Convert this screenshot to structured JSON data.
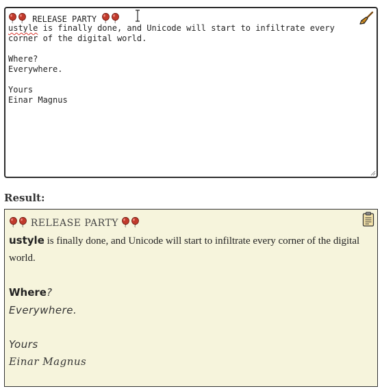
{
  "editor": {
    "lines": [
      "RELEASE PARTY",
      "is finally done, and Unicode will start to infiltrate every",
      "corner of the digital world.",
      "",
      "Where?",
      "Everywhere.",
      "",
      "Yours",
      "Einar Magnus"
    ],
    "misspelled_word": "ustyle",
    "clear_icon": "broom-icon"
  },
  "result_label": "Result:",
  "result": {
    "title": "RELEASE PARTY",
    "strong_word": "ustyle",
    "body_text": " is finally done, and Unicode will start to infiltrate every corner of the digital world.",
    "where_bold": "Where",
    "where_punct": "?",
    "everywhere": "Everywhere.",
    "yours": "Yours",
    "signature": "Einar Magnus",
    "copy_icon": "clipboard-icon"
  },
  "colors": {
    "balloon": "#c0392b",
    "result_bg": "#f6f4dc",
    "broom": "#d08a1c"
  }
}
